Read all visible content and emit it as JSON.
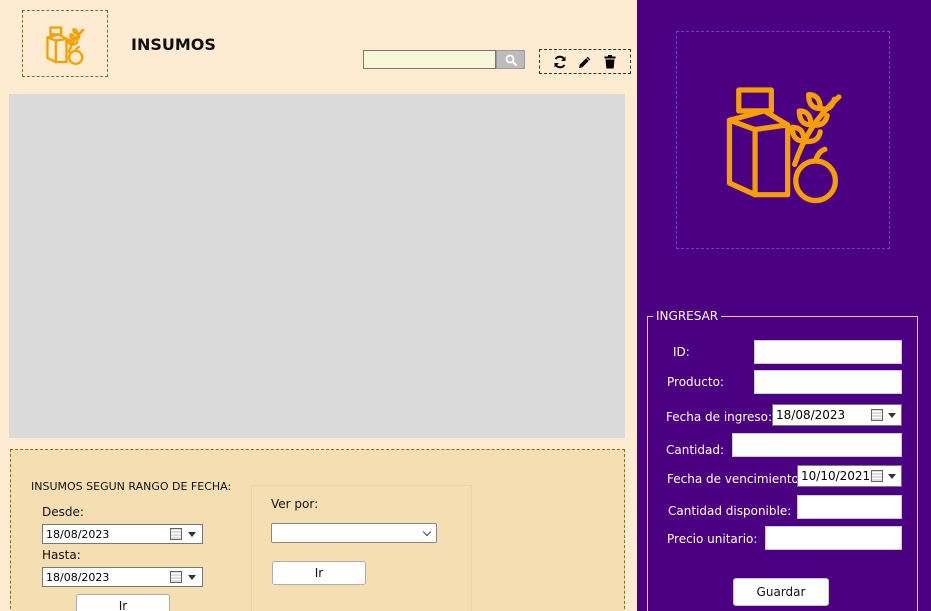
{
  "header": {
    "title": "INSUMOS",
    "search_value": ""
  },
  "toolbar": {
    "refresh_icon": "refresh-icon",
    "edit_icon": "pencil-icon",
    "delete_icon": "trash-icon"
  },
  "filter": {
    "title": "INSUMOS SEGUN RANGO DE FECHA:",
    "desde_label": "Desde:",
    "desde_value": "18/08/2023",
    "hasta_label": "Hasta:",
    "hasta_value": "18/08/2023",
    "go_label": "Ir",
    "ver_por_label": "Ver por:",
    "ver_por_value": "",
    "ver_go_label": "Ir"
  },
  "form": {
    "group_title": "INGRESAR",
    "id_label": "ID:",
    "producto_label": "Producto:",
    "fecha_ingreso_label": "Fecha de ingreso:",
    "fecha_ingreso_value": "18/08/2023",
    "cantidad_label": "Cantidad:",
    "fecha_venc_label": "Fecha de vencimiento:",
    "fecha_venc_value": "10/10/2021",
    "cantidad_disp_label": "Cantidad disponible:",
    "precio_label": "Precio unitario:",
    "save_label": "Guardar"
  },
  "colors": {
    "left_bg": "#feebd1",
    "right_bg": "#4b0082",
    "accent": "#f5a000",
    "table_bg": "#dadada",
    "filter_bg": "#f6deb3"
  }
}
